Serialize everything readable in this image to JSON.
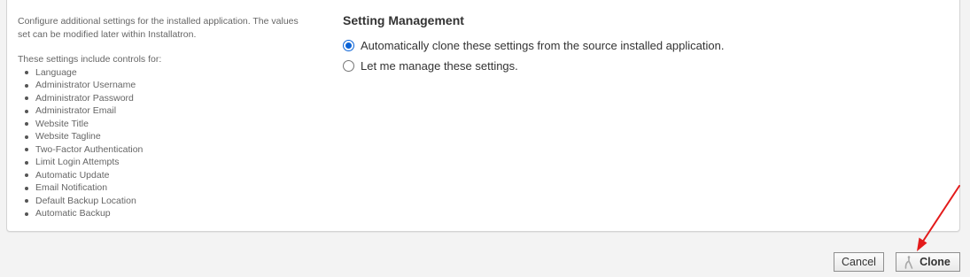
{
  "left": {
    "description": "Configure additional settings for the installed application. The values set can be modified later within Installatron.",
    "includes_label": "These settings include controls for:",
    "controls": [
      "Language",
      "Administrator Username",
      "Administrator Password",
      "Administrator Email",
      "Website Title",
      "Website Tagline",
      "Two-Factor Authentication",
      "Limit Login Attempts",
      "Automatic Update",
      "Email Notification",
      "Default Backup Location",
      "Automatic Backup"
    ]
  },
  "setting_management": {
    "title": "Setting Management",
    "options": [
      {
        "label": "Automatically clone these settings from the source installed application.",
        "selected": true
      },
      {
        "label": "Let me manage these settings.",
        "selected": false
      }
    ]
  },
  "buttons": {
    "cancel": "Cancel",
    "clone": "Clone",
    "clone_icon": "clone-icon"
  },
  "colors": {
    "accent": "#0b63d6",
    "annotation_arrow": "#e31b1b"
  }
}
